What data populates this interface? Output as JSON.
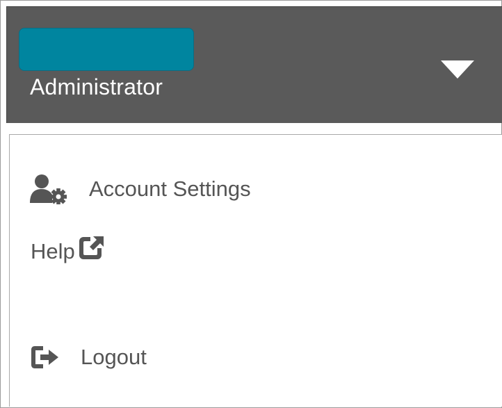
{
  "header": {
    "user_name_redacted": "",
    "role": "Administrator",
    "pill_color": "#00859f",
    "background_color": "#5a5a5a",
    "toggle_icon": "caret-down-icon"
  },
  "menu": {
    "items": [
      {
        "label": "Account Settings",
        "icon": "user-gear-icon"
      },
      {
        "label": "Help",
        "icon": "external-link-icon"
      },
      {
        "label": "Logout",
        "icon": "sign-out-icon"
      }
    ]
  }
}
